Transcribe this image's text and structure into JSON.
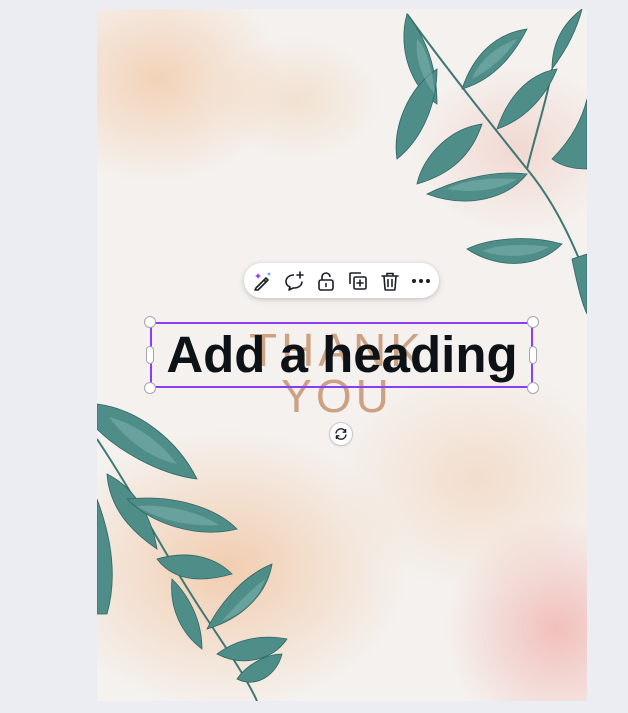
{
  "design": {
    "heading_text": "Add a heading",
    "background_text": "THANK YOU"
  },
  "toolbar": {
    "items": [
      {
        "name": "magic-write",
        "icon": "magic-pen-icon"
      },
      {
        "name": "comment",
        "icon": "comment-add-icon"
      },
      {
        "name": "lock",
        "icon": "unlock-icon"
      },
      {
        "name": "duplicate",
        "icon": "duplicate-icon"
      },
      {
        "name": "delete",
        "icon": "trash-icon"
      },
      {
        "name": "more",
        "icon": "more-horizontal-icon"
      }
    ]
  },
  "colors": {
    "selection": "#8b3dff",
    "leaf": "#4f8d89",
    "background": "#ecedf3"
  }
}
